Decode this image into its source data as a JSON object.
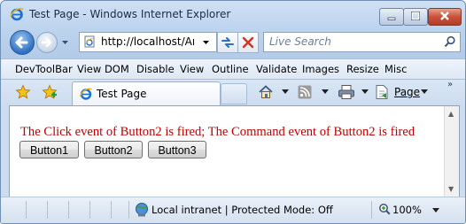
{
  "window": {
    "title": "Test Page - Windows Internet Explorer"
  },
  "navigation": {
    "address": "http://localhost/Art",
    "search_placeholder": "Live Search"
  },
  "menubar": {
    "items": [
      "DevToolBar",
      "View DOM",
      "Disable",
      "View",
      "Outline",
      "Validate",
      "Images",
      "Resize",
      "Misc"
    ]
  },
  "tabs": {
    "active_label": "Test Page",
    "page_menu_label": "Page",
    "chevron": "»"
  },
  "content": {
    "message": "The Click event of Button2 is fired; The Command event of Button2 is fired",
    "buttons": [
      "Button1",
      "Button2",
      "Button3"
    ]
  },
  "statusbar": {
    "zone_text": "Local intranet | Protected Mode: Off",
    "zoom": "100%"
  },
  "colors": {
    "message": "#c00000",
    "chrome": "#bcd3ee"
  }
}
